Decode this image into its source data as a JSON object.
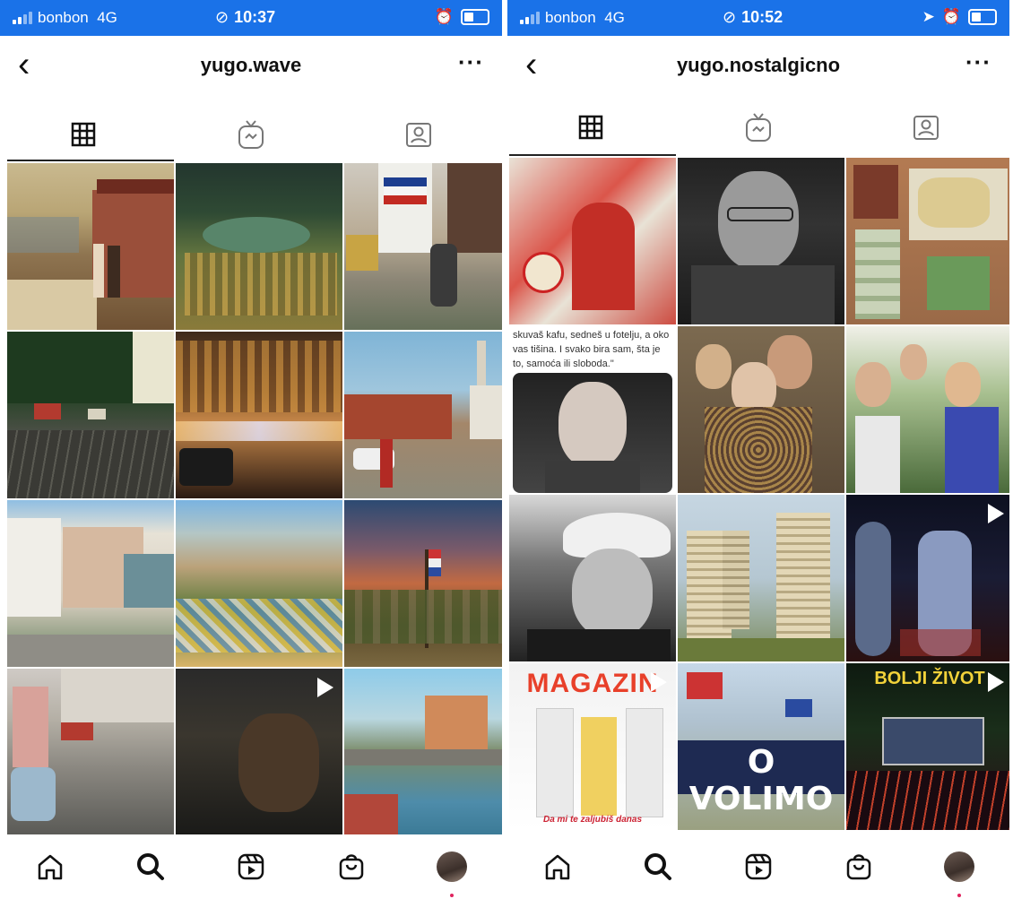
{
  "left_phone": {
    "status": {
      "carrier": "bonbon",
      "network": "4G",
      "time": "10:37"
    },
    "header": {
      "title": "yugo.wave",
      "back_icon": "chevron-left-icon",
      "more_label": "···"
    },
    "tabs": [
      "grid-icon",
      "igtv-icon",
      "tagged-icon"
    ],
    "posts": [
      {
        "label": "coastal-couple-photo"
      },
      {
        "label": "night-pool-photo"
      },
      {
        "label": "child-yugoslav-flag-photo"
      },
      {
        "label": "tree-lined-road-photo"
      },
      {
        "label": "city-night-lights-photo"
      },
      {
        "label": "town-street-photo"
      },
      {
        "label": "city-square-photo"
      },
      {
        "label": "market-town-photo"
      },
      {
        "label": "soldiers-flag-photo"
      },
      {
        "label": "woman-scooter-photo",
        "video": false
      },
      {
        "label": "man-portrait-video",
        "video": true
      },
      {
        "label": "river-bridge-photo"
      }
    ]
  },
  "right_phone": {
    "status": {
      "carrier": "bonbon",
      "network": "4G",
      "time": "10:52"
    },
    "header": {
      "title": "yugo.nostalgicno",
      "back_icon": "chevron-left-icon",
      "more_label": "···"
    },
    "tabs": [
      "grid-icon",
      "igtv-icon",
      "tagged-icon"
    ],
    "post_text": "skuvaš kafu, sedneš u fotelju, a oko vas tišina. I svako bira sam, šta je to, samoća ili sloboda.\"",
    "banner_text": "O VOLIMO",
    "magazin_text": "MAGAZIN",
    "magazin_subtext": "Da mi te zaljubiš danas",
    "bolji_text": "BOLJI ŽIVOT",
    "posts": [
      {
        "label": "propaganda-poster"
      },
      {
        "label": "man-glasses-portrait"
      },
      {
        "label": "map-banknotes-photo"
      },
      {
        "label": "quote-woman-post"
      },
      {
        "label": "three-women-photo"
      },
      {
        "label": "friends-group-photo"
      },
      {
        "label": "sailor-cap-portrait"
      },
      {
        "label": "towers-photo"
      },
      {
        "label": "stage-video",
        "video": true
      },
      {
        "label": "magazin-cover",
        "video": true
      },
      {
        "label": "volimo-banner-photo"
      },
      {
        "label": "bolji-zivot-cover",
        "video": true
      }
    ]
  },
  "bottom_nav": [
    "home-icon",
    "search-icon",
    "reels-icon",
    "shop-icon",
    "profile-avatar"
  ]
}
